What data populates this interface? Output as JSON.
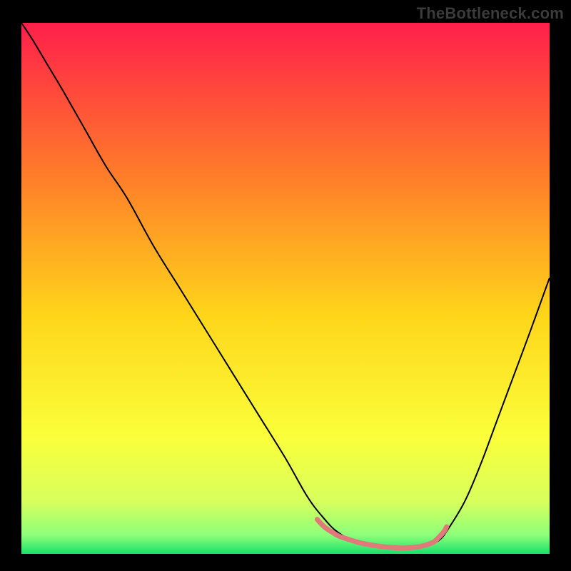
{
  "watermark": "TheBottleneck.com",
  "chart_data": {
    "type": "line",
    "title": "",
    "xlabel": "",
    "ylabel": "",
    "xlim": [
      0,
      100
    ],
    "ylim": [
      0,
      100
    ],
    "grid": false,
    "legend": false,
    "background_gradient": {
      "stops": [
        {
          "offset": 0.0,
          "color": "#ff1f4b"
        },
        {
          "offset": 0.28,
          "color": "#ff7a2a"
        },
        {
          "offset": 0.55,
          "color": "#ffd51a"
        },
        {
          "offset": 0.78,
          "color": "#faff3a"
        },
        {
          "offset": 0.9,
          "color": "#d8ff5c"
        },
        {
          "offset": 0.965,
          "color": "#8dff7a"
        },
        {
          "offset": 1.0,
          "color": "#18e06a"
        }
      ]
    },
    "series": [
      {
        "name": "bottleneck-curve",
        "color": "#000000",
        "width": 2,
        "x": [
          0,
          2,
          5,
          8,
          12,
          16,
          20,
          25,
          30,
          35,
          40,
          45,
          50,
          54,
          57,
          60,
          64,
          68,
          72,
          76,
          79,
          81,
          84,
          87,
          90,
          93,
          96,
          100
        ],
        "y": [
          100,
          97,
          92,
          87,
          80,
          73,
          67,
          58,
          50,
          42,
          34,
          26,
          18,
          11,
          7,
          4,
          2,
          1.2,
          1,
          1.3,
          2.5,
          5,
          10,
          17,
          25,
          33,
          41,
          52
        ]
      },
      {
        "name": "optimal-band-marker",
        "color": "#e07a7a",
        "width": 7,
        "x": [
          56,
          57,
          58,
          59,
          60,
          62,
          64,
          66,
          68,
          70,
          72,
          74,
          76,
          78,
          79,
          80,
          80.5
        ],
        "y": [
          6.5,
          5.4,
          4.6,
          4.0,
          3.4,
          2.7,
          2.1,
          1.7,
          1.4,
          1.2,
          1.1,
          1.2,
          1.5,
          2.2,
          3.1,
          4.2,
          5.1
        ]
      }
    ]
  }
}
